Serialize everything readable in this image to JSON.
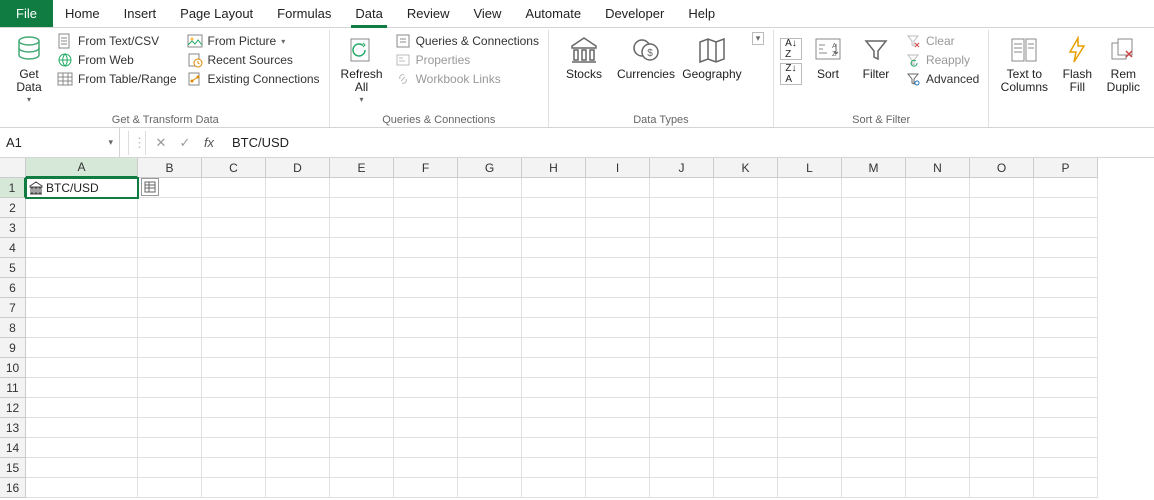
{
  "tabs": {
    "file": "File",
    "items": [
      "Home",
      "Insert",
      "Page Layout",
      "Formulas",
      "Data",
      "Review",
      "View",
      "Automate",
      "Developer",
      "Help"
    ],
    "active": "Data"
  },
  "ribbon": {
    "get_transform": {
      "get_data": "Get\nData",
      "from_text_csv": "From Text/CSV",
      "from_web": "From Web",
      "from_table_range": "From Table/Range",
      "from_picture": "From Picture",
      "recent_sources": "Recent Sources",
      "existing_connections": "Existing Connections",
      "label": "Get & Transform Data"
    },
    "queries": {
      "refresh_all": "Refresh\nAll",
      "queries_connections": "Queries & Connections",
      "properties": "Properties",
      "workbook_links": "Workbook Links",
      "label": "Queries & Connections"
    },
    "data_types": {
      "stocks": "Stocks",
      "currencies": "Currencies",
      "geography": "Geography",
      "label": "Data Types"
    },
    "sort_filter": {
      "sort": "Sort",
      "filter": "Filter",
      "clear": "Clear",
      "reapply": "Reapply",
      "advanced": "Advanced",
      "label": "Sort & Filter"
    },
    "data_tools": {
      "text_to_columns": "Text to\nColumns",
      "flash_fill": "Flash\nFill",
      "remove_duplicates": "Rem\nDuplic"
    }
  },
  "formula_bar": {
    "name_box": "A1",
    "formula": "BTC/USD"
  },
  "grid": {
    "columns": [
      "A",
      "B",
      "C",
      "D",
      "E",
      "F",
      "G",
      "H",
      "I",
      "J",
      "K",
      "L",
      "M",
      "N",
      "O",
      "P"
    ],
    "row_count": 16,
    "active_cell": {
      "row": 1,
      "col": "A",
      "value": "BTC/USD"
    }
  }
}
